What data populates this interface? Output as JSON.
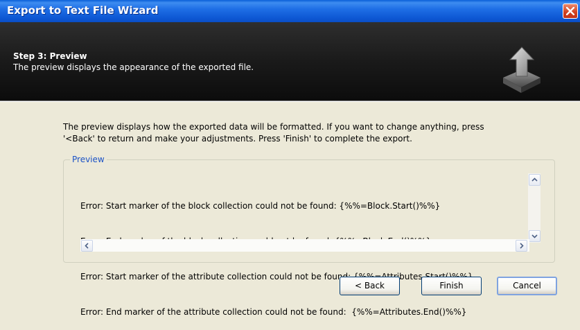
{
  "window": {
    "title": "Export to Text File Wizard"
  },
  "header": {
    "step": "Step 3: Preview",
    "description": "The preview displays the appearance of the exported file.",
    "icon": "export-arrow-tray-icon"
  },
  "intro": {
    "line1": "The preview displays how the exported data will be formatted. If you want to change anything, press",
    "line2": "'<Back' to return and make your adjustments. Press 'Finish' to complete the export."
  },
  "preview": {
    "group_label": "Preview",
    "lines": [
      "Error: Start marker of the block collection could not be found: {%%=Block.Start()%%}",
      "Error: End marker of the block collection could not be found: {%%=Block.End()%%}",
      "Error: Start marker of the attribute collection could not be found: {%%=Attributes.Start()%%}",
      "Error: End marker of the attribute collection could not be found:  {%%=Attributes.End()%%}"
    ]
  },
  "buttons": {
    "back": "< Back",
    "finish": "Finish",
    "cancel": "Cancel"
  }
}
